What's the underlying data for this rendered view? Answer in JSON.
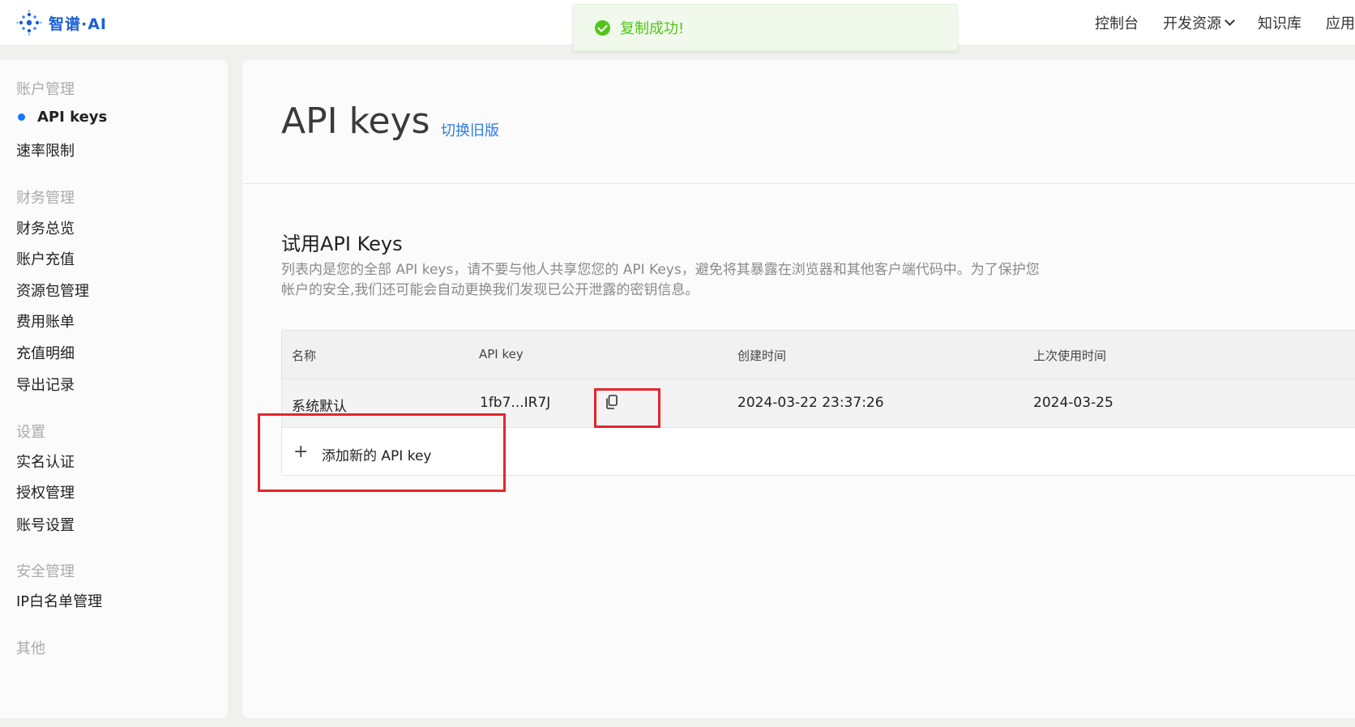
{
  "header": {
    "logo_text": "智谱·AI",
    "nav": [
      "控制台",
      "开发资源",
      "知识库",
      "应用"
    ]
  },
  "toast": {
    "message": "复制成功!",
    "color": "#52c41a"
  },
  "sidebar": {
    "groups": [
      {
        "title": "账户管理",
        "items": [
          "API keys",
          "速率限制"
        ]
      },
      {
        "title": "财务管理",
        "items": [
          "财务总览",
          "账户充值",
          "资源包管理",
          "费用账单",
          "充值明细",
          "导出记录"
        ]
      },
      {
        "title": "设置",
        "items": [
          "实名认证",
          "授权管理",
          "账号设置"
        ]
      },
      {
        "title": "安全管理",
        "items": [
          "IP白名单管理"
        ]
      },
      {
        "title": "其他",
        "items": []
      }
    ],
    "active_item": "API keys",
    "accent": "#1677ff"
  },
  "main": {
    "title": "API keys",
    "switch_link": "切换旧版",
    "section_title": "试用API Keys",
    "description": "列表内是您的全部 API keys，请不要与他人共享您您的 API Keys，避免将其暴露在浏览器和其他客户端代码中。为了保护您帐户的安全,我们还可能会自动更换我们发现已公开泄露的密钥信息。",
    "table": {
      "headers": [
        "名称",
        "API key",
        "创建时间",
        "上次使用时间"
      ],
      "rows": [
        {
          "name": "系统默认",
          "key": "1fb7...IR7J",
          "created": "2024-03-22 23:37:26",
          "last_used": "2024-03-25"
        }
      ],
      "add_label": "添加新的 API key"
    }
  }
}
